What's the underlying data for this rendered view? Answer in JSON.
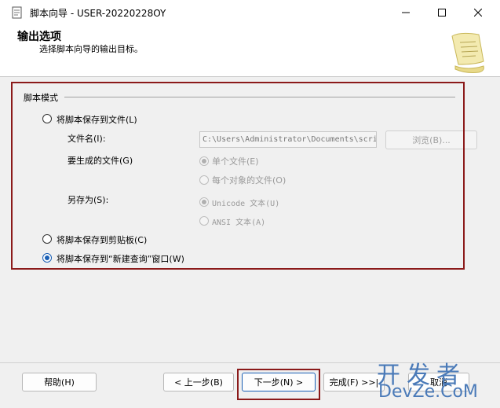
{
  "window": {
    "title": "脚本向导 - USER-20220228OY",
    "min_label": "—",
    "max_label": "☐",
    "close_label": "✕"
  },
  "header": {
    "title": "输出选项",
    "subtitle": "选择脚本向导的输出目标。"
  },
  "group": {
    "label": "脚本模式"
  },
  "options": {
    "save_file": "将脚本保存到文件(L)",
    "file_name_label": "文件名(I):",
    "file_name_value": "C:\\Users\\Administrator\\Documents\\scri",
    "browse_label": "浏览(B)...",
    "gen_files_label": "要生成的文件(G)",
    "single_file": "单个文件(E)",
    "per_object_file": "每个对象的文件(O)",
    "save_as_label": "另存为(S):",
    "unicode_text": "Unicode 文本(U)",
    "ansi_text": "ANSI 文本(A)",
    "save_clipboard": "将脚本保存到剪贴板(C)",
    "save_new_query": "将脚本保存到“新建查询”窗口(W)"
  },
  "footer": {
    "help": "帮助(H)",
    "back": "< 上一步(B)",
    "next": "下一步(N) >",
    "finish": "完成(F) >>|",
    "cancel": "取消"
  },
  "watermark": {
    "top": "开发者",
    "bottom": "DevZe.CoM"
  }
}
